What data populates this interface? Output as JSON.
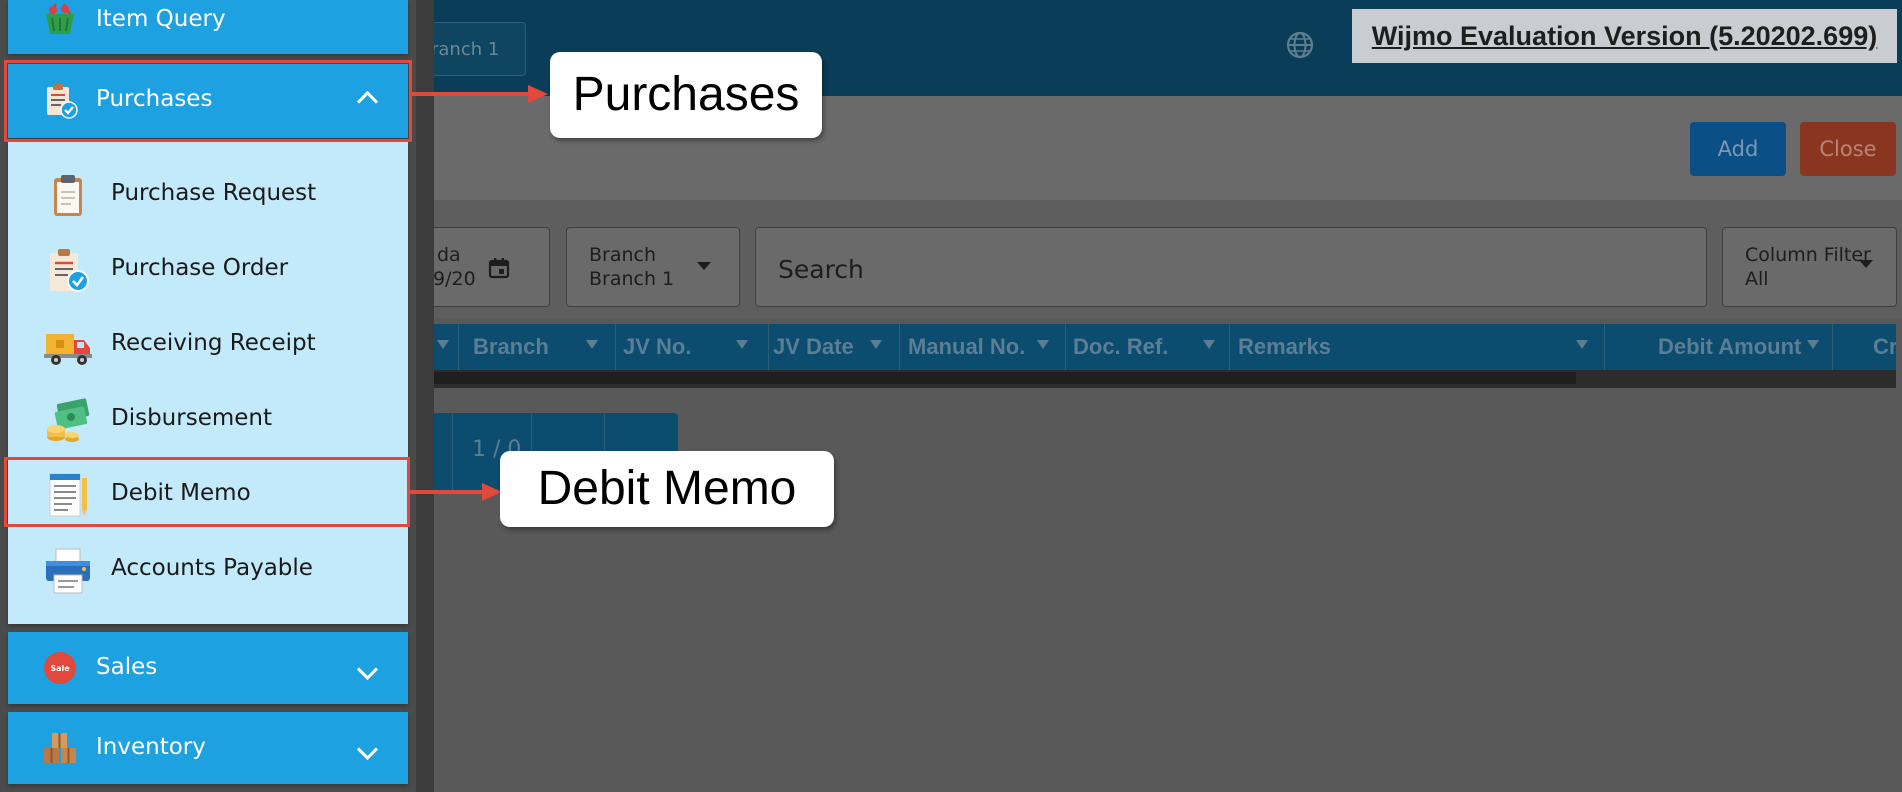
{
  "watermark": "Wijmo Evaluation Version (5.20202.699)",
  "header": {
    "branch_pill": "ranch 1"
  },
  "toolbar": {
    "add_label": "Add",
    "close_label": "Close"
  },
  "filters": {
    "date_label": "da",
    "date_value": "9/20",
    "branch_label": "Branch",
    "branch_value": "Branch 1",
    "search_placeholder": "Search",
    "column_filter_label": "Column Filter",
    "column_filter_value": "All"
  },
  "grid": {
    "columns": [
      "Branch",
      "JV No.",
      "JV Date",
      "Manual No.",
      "Doc. Ref.",
      "Remarks",
      "Debit Amount",
      "Cr"
    ]
  },
  "pager": {
    "text": "1 / 0"
  },
  "sidebar": {
    "top_item": {
      "label": "Item Query",
      "icon": "basket-icon"
    },
    "purchases": {
      "label": "Purchases",
      "icon": "purchases-clipboard-icon",
      "expanded": true,
      "items": [
        {
          "label": "Purchase Request",
          "icon": "clipboard-icon"
        },
        {
          "label": "Purchase Order",
          "icon": "order-check-icon"
        },
        {
          "label": "Receiving Receipt",
          "icon": "delivery-truck-icon"
        },
        {
          "label": "Disbursement",
          "icon": "money-stack-icon"
        },
        {
          "label": "Debit Memo",
          "icon": "memo-document-icon"
        },
        {
          "label": "Accounts Payable",
          "icon": "printer-icon"
        }
      ]
    },
    "sales": {
      "label": "Sales",
      "icon": "sale-tag-icon",
      "badge": "Sale"
    },
    "inventory": {
      "label": "Inventory",
      "icon": "boxes-icon"
    }
  },
  "callouts": {
    "purchases": "Purchases",
    "debit_memo": "Debit Memo"
  },
  "colors": {
    "sidebar_item": "#1ea1e1",
    "submenu_bg": "#c3eafa",
    "highlight_border": "#e0493b",
    "topbar": "#0a3e58",
    "grid_header": "#0b4c6f"
  }
}
